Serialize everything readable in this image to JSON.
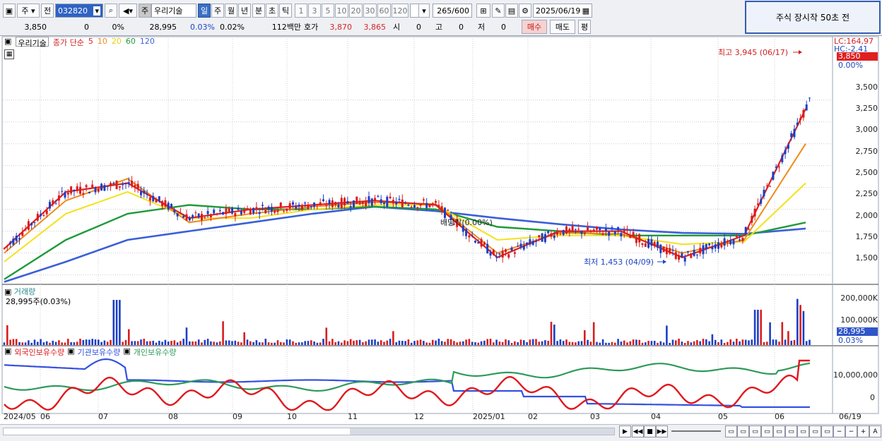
{
  "toolbar": {
    "type_label": "주",
    "prev_label": "전",
    "code_value": "032820",
    "mode_label": "주",
    "name_value": "우리기술",
    "period_tabs": [
      "일",
      "주",
      "월",
      "년",
      "분",
      "초",
      "틱"
    ],
    "interval_buttons": [
      "1",
      "3",
      "5",
      "10",
      "20",
      "30",
      "60",
      "120"
    ],
    "count_value": "265",
    "count_total": "/600",
    "date_value": "2025/06/19"
  },
  "quote": {
    "price": "3,850",
    "change": "0",
    "change_rate": "0%",
    "volume": "28,995",
    "volume_rate": "0.03%",
    "turnover_rate": "0.02%",
    "amount": "112백만",
    "hoga_label": "호가",
    "ask": "3,870",
    "bid": "3,865",
    "open_label": "시",
    "open": "0",
    "high_label": "고",
    "high": "0",
    "low_label": "저",
    "low": "0",
    "buy_label": "매수",
    "sell_label": "매도",
    "eval_label": "평"
  },
  "notice": "주식 장시작 50초 전",
  "price_panel": {
    "stock_name": "우리기술",
    "ma_title": "종가 단순",
    "ma_periods": [
      "5",
      "10",
      "20",
      "60",
      "120"
    ],
    "lc": "LC:164,97",
    "hc": "HC:-2.41",
    "current_price_tag": "3,850",
    "current_pct": "0.00%",
    "high_annot": "최고 3,945 (06/17)",
    "low_annot": "최저 1,453 (04/09)",
    "dividend_annot": "배당락(0.00%)",
    "y_ticks": [
      "3,500",
      "3,250",
      "3,000",
      "2,750",
      "2,500",
      "2,250",
      "2,000",
      "1,750",
      "1,500"
    ]
  },
  "volume_panel": {
    "title": "거래량",
    "value": "28,995주(0.03%)",
    "y_ticks": [
      "200,000K",
      "100,000K"
    ],
    "current_tag": "28,995",
    "current_pct": "0.03%"
  },
  "holding_panel": {
    "legend": [
      "외국인보유수량",
      "기관보유수량",
      "개인보유수량"
    ],
    "y_ticks": [
      "10,000,000",
      "0"
    ]
  },
  "x_axis": [
    "2024/05",
    "06",
    "07",
    "08",
    "09",
    "10",
    "11",
    "12",
    "2025/01",
    "02",
    "03",
    "04",
    "05",
    "06",
    "06/19"
  ],
  "colors": {
    "ma5": "#e02020",
    "ma10": "#f08a1c",
    "ma20": "#f3e21c",
    "ma60": "#1f9a3a",
    "ma120": "#3a5fd8",
    "up": "#d81e1e",
    "down": "#1d3fc4",
    "foreign": "#e0191e",
    "institution": "#3350e0",
    "individual": "#2e9a5a"
  },
  "chart_data": {
    "type": "line",
    "title": "우리기술",
    "x": [
      "2024/05",
      "06",
      "07",
      "08",
      "09",
      "10",
      "11",
      "12",
      "2025/01",
      "02",
      "03",
      "04",
      "05",
      "06"
    ],
    "ylim": [
      1400,
      3950
    ],
    "series": [
      {
        "name": "5",
        "values": [
          1800,
          2450,
          2550,
          2150,
          2250,
          2300,
          2350,
          2300,
          1700,
          2000,
          2000,
          1700,
          1950,
          3400
        ]
      },
      {
        "name": "10",
        "values": [
          1750,
          2350,
          2600,
          2100,
          2200,
          2280,
          2330,
          2310,
          1750,
          1980,
          1970,
          1750,
          1900,
          3000
        ]
      },
      {
        "name": "20",
        "values": [
          1650,
          2200,
          2450,
          2150,
          2150,
          2250,
          2300,
          2300,
          1900,
          1950,
          1950,
          1850,
          1880,
          2550
        ]
      },
      {
        "name": "60",
        "values": [
          1450,
          1900,
          2200,
          2300,
          2250,
          2250,
          2280,
          2250,
          2050,
          2000,
          1950,
          1950,
          1950,
          2100
        ]
      },
      {
        "name": "120",
        "values": [
          1420,
          1650,
          1900,
          2000,
          2100,
          2200,
          2280,
          2230,
          2150,
          2080,
          2020,
          1980,
          1970,
          2030
        ]
      }
    ],
    "annotations": [
      "최고 3,945 (06/17)",
      "최저 1,453 (04/09)",
      "배당락(0.00%)"
    ]
  }
}
